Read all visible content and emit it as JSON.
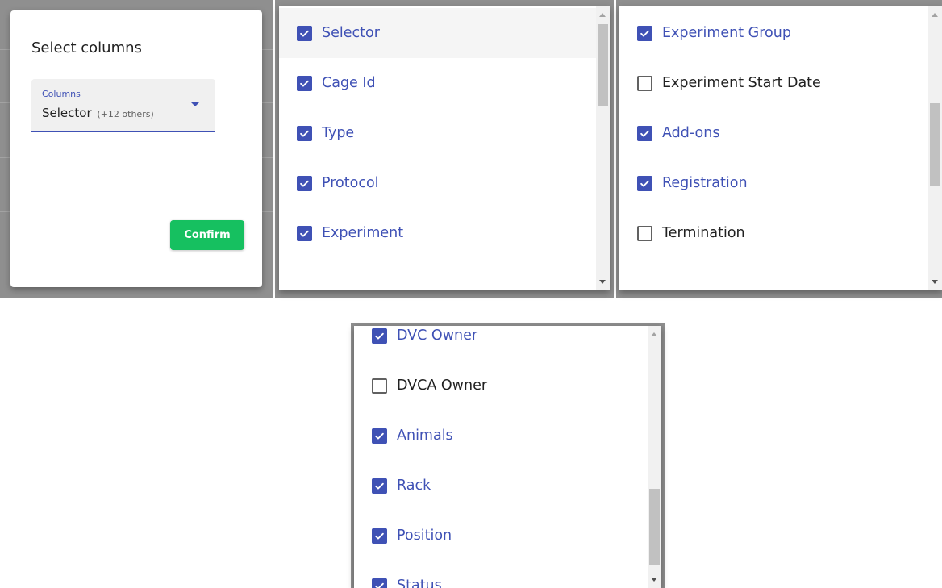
{
  "dialog": {
    "title": "Select columns",
    "field_label": "Columns",
    "selected_value": "Selector",
    "others_text": "(+12 others)",
    "confirm_label": "Confirm"
  },
  "colors": {
    "accent": "#3f51b5",
    "confirm": "#16c060",
    "backdrop": "#8f8f8f"
  },
  "list_a": {
    "items": [
      {
        "label": "Selector",
        "checked": true
      },
      {
        "label": "Cage Id",
        "checked": true
      },
      {
        "label": "Type",
        "checked": true
      },
      {
        "label": "Protocol",
        "checked": true
      },
      {
        "label": "Experiment",
        "checked": true
      }
    ]
  },
  "list_b": {
    "items": [
      {
        "label": "Experiment Group",
        "checked": true
      },
      {
        "label": "Experiment Start Date",
        "checked": false
      },
      {
        "label": "Add-ons",
        "checked": true
      },
      {
        "label": "Registration",
        "checked": true
      },
      {
        "label": "Termination",
        "checked": false
      }
    ]
  },
  "list_c": {
    "items": [
      {
        "label": "DVC Owner",
        "checked": true
      },
      {
        "label": "DVCA Owner",
        "checked": false
      },
      {
        "label": "Animals",
        "checked": true
      },
      {
        "label": "Rack",
        "checked": true
      },
      {
        "label": "Position",
        "checked": true
      },
      {
        "label": "Status",
        "checked": true
      }
    ]
  }
}
